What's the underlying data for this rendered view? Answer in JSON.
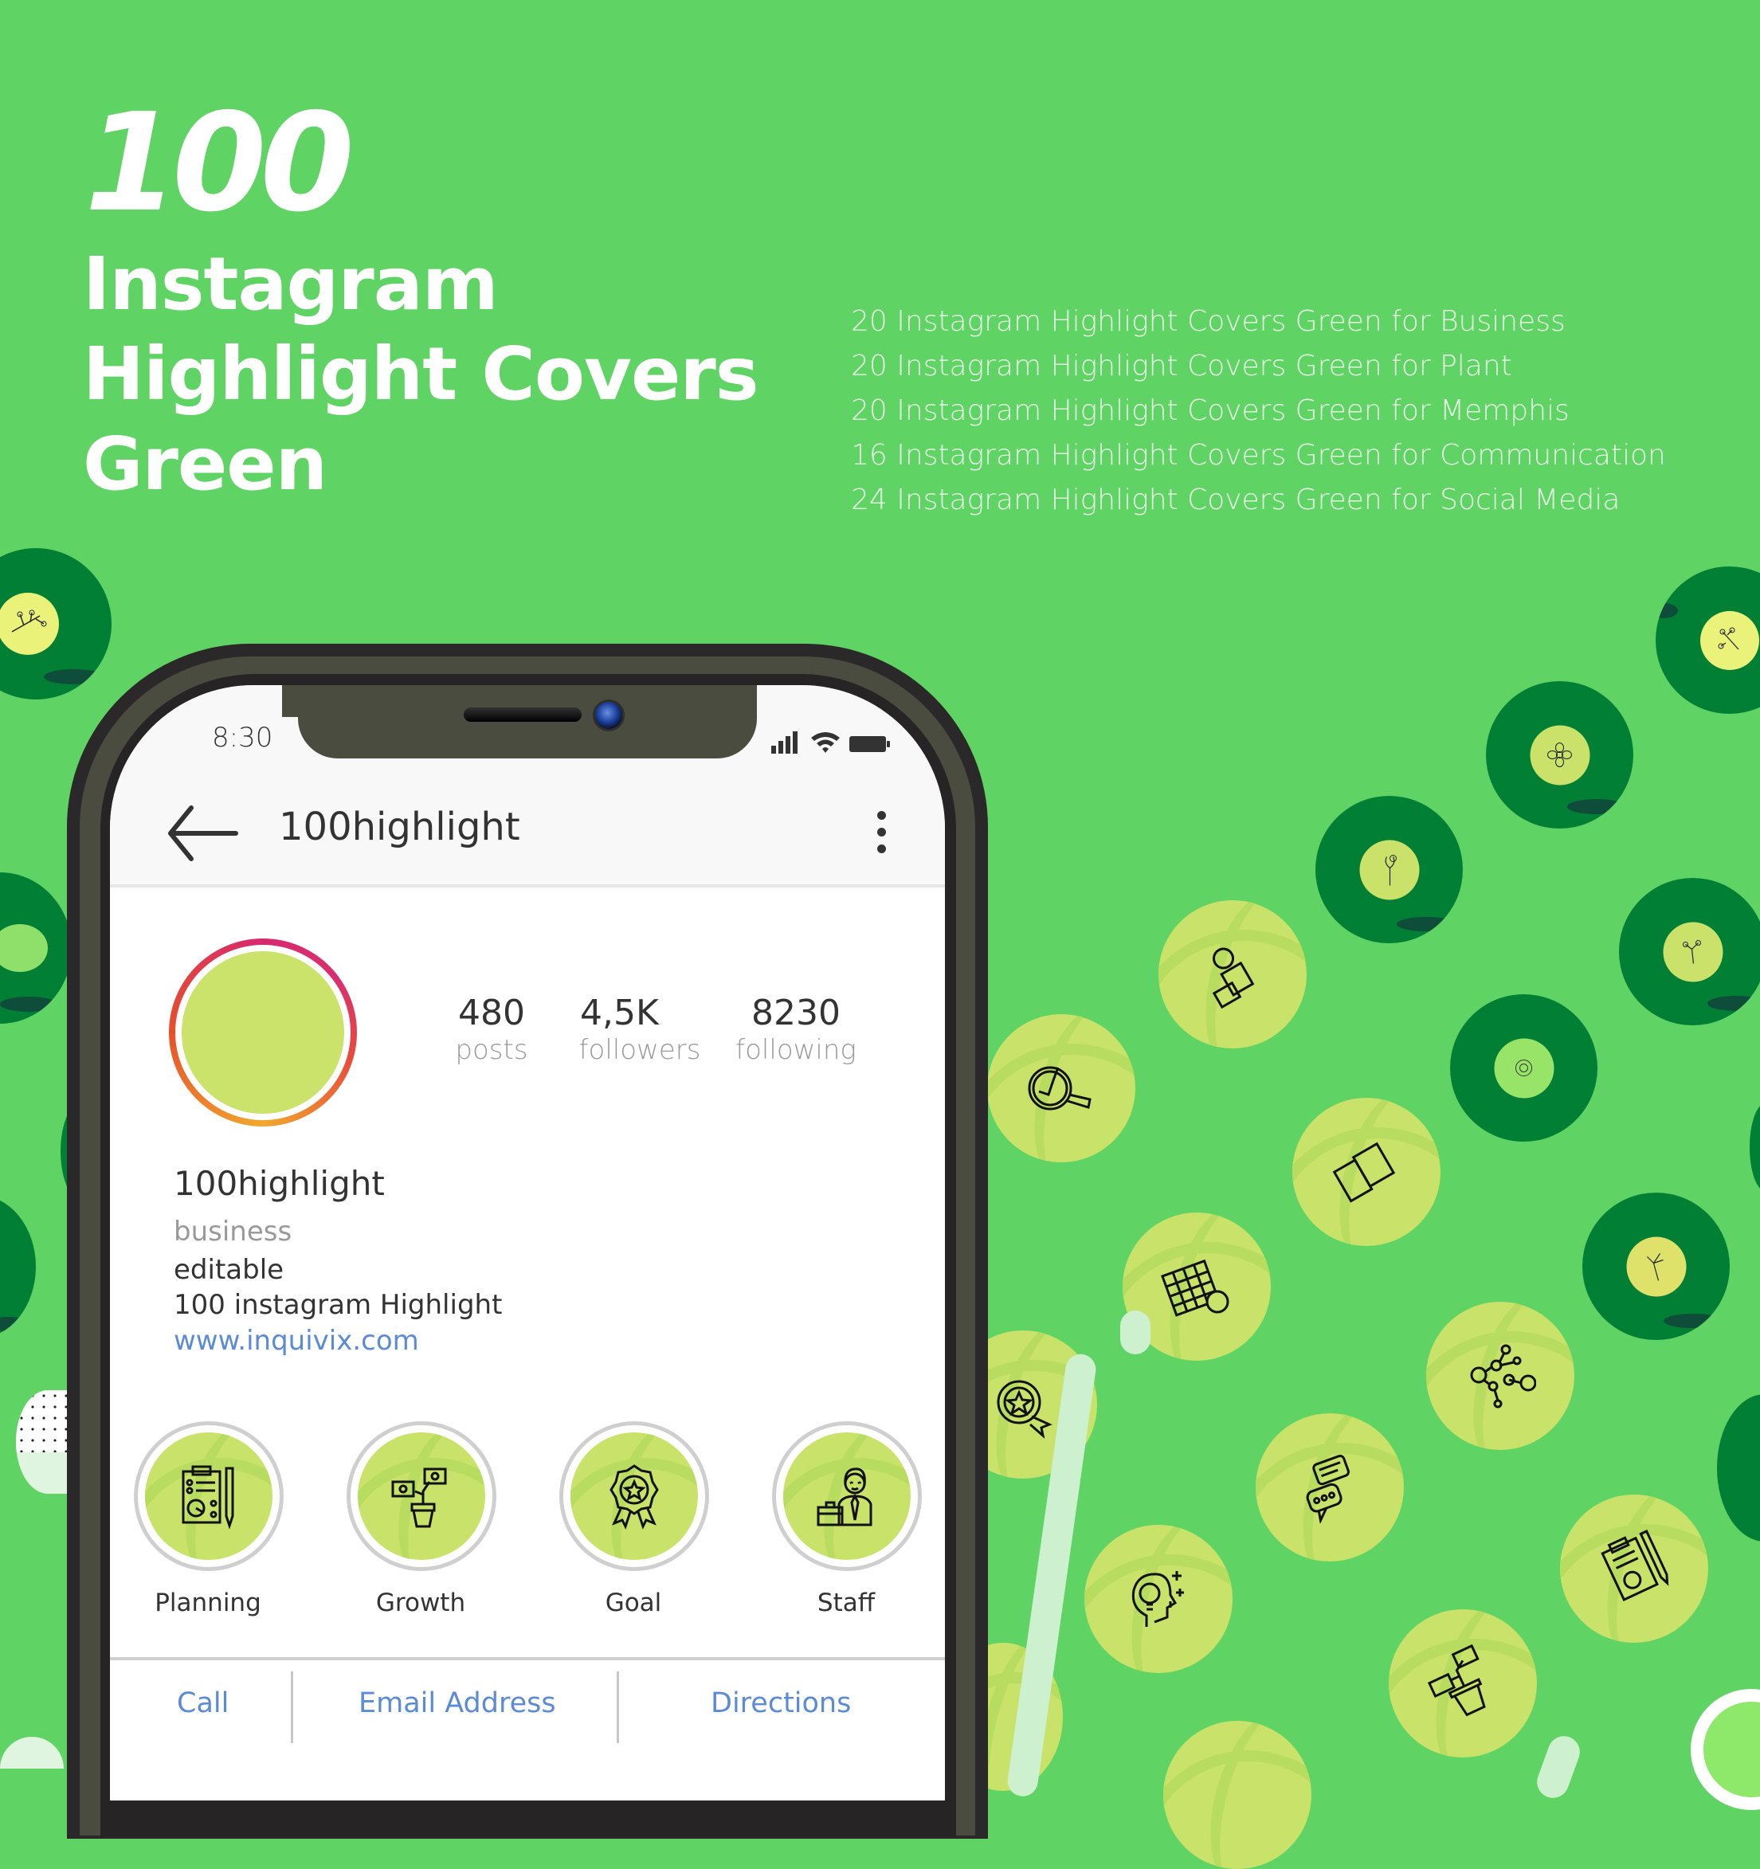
{
  "headline": {
    "number": "100",
    "lines": [
      "Instagram",
      "Highlight Covers",
      "Green"
    ]
  },
  "features": [
    "20 Instagram Highlight Covers Green for Business",
    "20 Instagram Highlight Covers Green for Plant",
    "20 Instagram Highlight Covers Green for Memphis",
    "16 Instagram Highlight Covers Green for Communication",
    "24 Instagram Highlight Covers Green for Social Media"
  ],
  "colors": {
    "background": "#5fd364",
    "dark_green": "#017f35",
    "lime": "#c8e26a",
    "link_blue": "#5b8bd6"
  },
  "phone": {
    "status_bar": {
      "time": "8:30",
      "icons": [
        "signal-icon",
        "wifi-icon",
        "battery-icon"
      ]
    },
    "app_bar": {
      "back_icon": "arrow-left-icon",
      "username": "100highlight",
      "menu_icon": "more-vertical-icon"
    },
    "profile": {
      "stats": [
        {
          "value": "480",
          "label": "posts"
        },
        {
          "value": "4,5K",
          "label": "followers"
        },
        {
          "value": "8230",
          "label": "following"
        }
      ],
      "name": "100highlight",
      "category": "business",
      "bio_lines": [
        "editable",
        "100 instagram Highlight"
      ],
      "website": "www.inquivix.com"
    },
    "highlights": [
      {
        "label": "Planning",
        "icon": "clipboard-chart-icon"
      },
      {
        "label": "Growth",
        "icon": "money-plant-icon"
      },
      {
        "label": "Goal",
        "icon": "award-badge-icon"
      },
      {
        "label": "Staff",
        "icon": "businessman-icon"
      }
    ],
    "contact_buttons": [
      "Call",
      "Email Address",
      "Directions"
    ]
  }
}
